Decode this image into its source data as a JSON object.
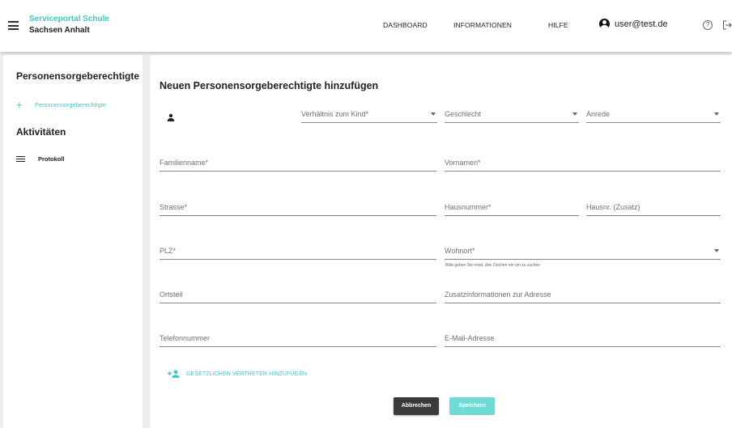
{
  "header": {
    "brand_line1": "Serviceportal Schule",
    "brand_line2": "Sachsen Anhalt",
    "nav": [
      "DASHBOARD",
      "INFORMATIONEN",
      "HILFE"
    ],
    "user": "user@test.de"
  },
  "sidebar": {
    "section1_title": "Personensorgeberechtigte",
    "add_label": "Personensorgeberechtigte",
    "section2_title": "Aktivitäten",
    "protocol_label": "Protokoll"
  },
  "form": {
    "title": "Neuen Personensorgeberechtigte hinzufügen",
    "relation": "Verhältnis zum Kind*",
    "gender": "Geschlecht",
    "salutation": "Anrede",
    "lastname": "Familienname*",
    "firstname": "Vornamen*",
    "street": "Strasse*",
    "house_number": "Hausnummer*",
    "house_number_add": "Hausnr. (Zusatz)",
    "zip": "PLZ*",
    "city": "Wohnort*",
    "city_hint": "Bitte geben Sie mind. drei Zeichen ein um zu suchen",
    "district": "Ortsteil",
    "address_info": "Zusatzinformationen zur Adresse",
    "phone": "Telefonnummer",
    "email": "E-Mail-Adresse",
    "add_representative": "GESETZLICHEN VERTRETER HINZUFÜGEN",
    "cancel": "Abbrechen",
    "save": "Speichern"
  },
  "colors": {
    "accent": "#3fc7c1",
    "save_button": "#70dbd4",
    "cancel_button": "#3b3b3b",
    "background": "#eeeeee"
  }
}
